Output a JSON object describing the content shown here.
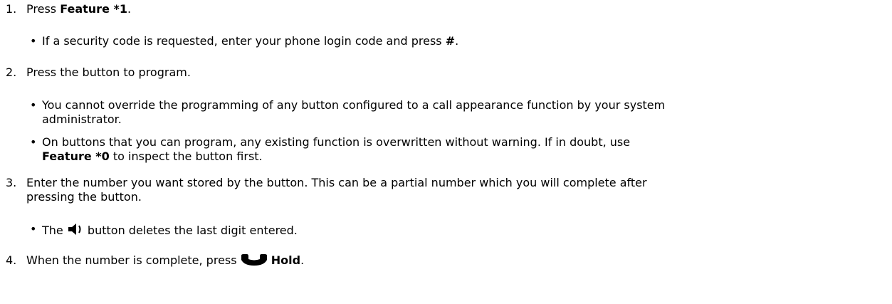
{
  "steps": [
    {
      "num": "1.",
      "pre": "Press ",
      "key": "Feature *1",
      "post": ".",
      "bullets": [
        {
          "pre": "If a security code is requested, enter your phone login code and press ",
          "key": "#",
          "post": "."
        }
      ]
    },
    {
      "num": "2.",
      "text": "Press the button to program.",
      "bullets": [
        {
          "line1": "You cannot override the programming of any button configured to a call appearance function by your system",
          "line2": "administrator."
        },
        {
          "line1": "On buttons that you can program, any existing function is overwritten without warning. If in doubt, use",
          "line2_key": "Feature *0",
          "line2_post": " to inspect the button first."
        }
      ]
    },
    {
      "num": "3.",
      "line1": "Enter the number you want stored by the button. This can be a partial number which you will complete after",
      "line2": "pressing the button.",
      "bullets": [
        {
          "pre": "The ",
          "icon": "speaker-icon",
          "post": " button deletes the last digit entered."
        }
      ]
    },
    {
      "num": "4.",
      "pre": "When the number is complete, press ",
      "icon": "handset-icon",
      "key": "Hold",
      "post": "."
    }
  ],
  "bullet_char": "•"
}
